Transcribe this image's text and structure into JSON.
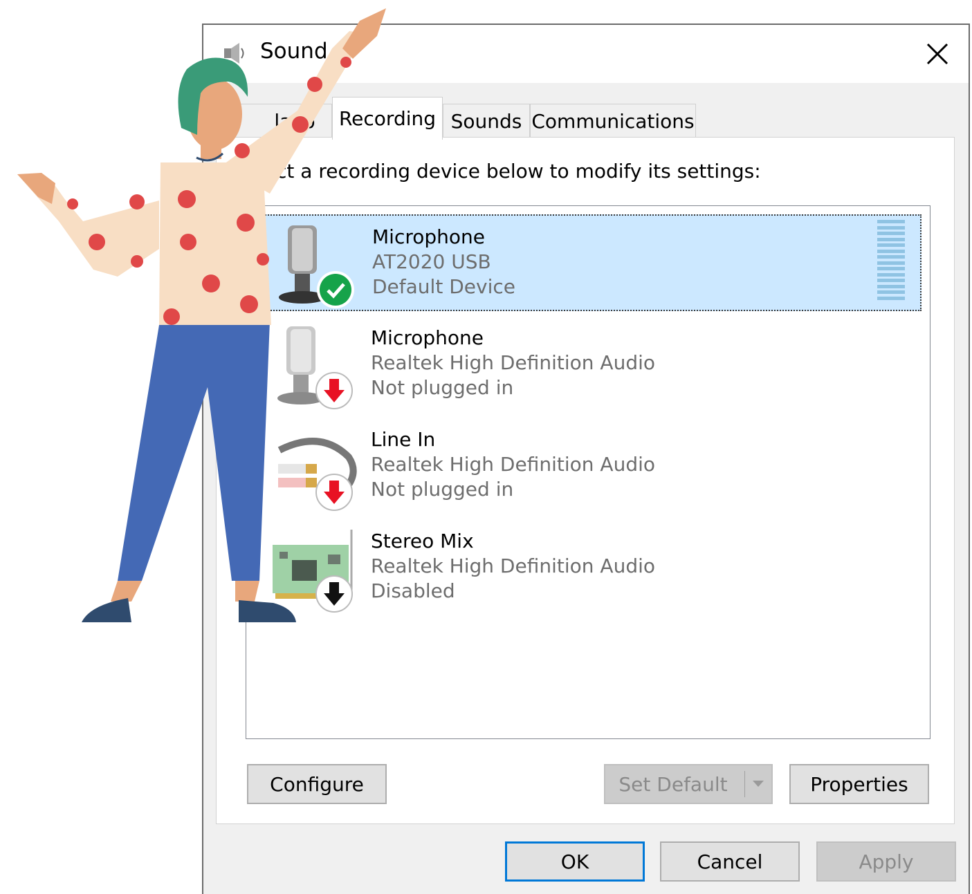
{
  "window": {
    "title": "Sound"
  },
  "tabs": [
    {
      "label": "Playback",
      "visible_label": "layb",
      "active": false
    },
    {
      "label": "Recording",
      "active": true
    },
    {
      "label": "Sounds",
      "active": false
    },
    {
      "label": "Communications",
      "active": false
    }
  ],
  "instruction": "Select a recording device below to modify its settings:",
  "instruction_visible": "ct a recording device below to modify its settings:",
  "devices": [
    {
      "name": "Microphone",
      "driver": "AT2020 USB",
      "status": "Default Device",
      "icon": "microphone-icon",
      "badge": "default-check-icon",
      "selected": true
    },
    {
      "name": "Microphone",
      "driver": "Realtek High Definition Audio",
      "status": "Not plugged in",
      "icon": "microphone-icon",
      "badge": "unplugged-arrow-icon",
      "selected": false
    },
    {
      "name": "Line In",
      "driver": "Realtek High Definition Audio",
      "status": "Not plugged in",
      "icon": "line-in-cable-icon",
      "badge": "unplugged-arrow-icon",
      "selected": false
    },
    {
      "name": "Stereo Mix",
      "driver": "Realtek High Definition Audio",
      "status": "Disabled",
      "icon": "sound-card-icon",
      "badge": "disabled-arrow-icon",
      "selected": false
    }
  ],
  "buttons": {
    "configure": "Configure",
    "set_default": "Set Default",
    "properties": "Properties",
    "ok": "OK",
    "cancel": "Cancel",
    "apply": "Apply"
  },
  "colors": {
    "selection": "#cce8ff",
    "default_green": "#16a34a",
    "unplugged_red": "#e81123",
    "focus_blue": "#0078d7"
  }
}
